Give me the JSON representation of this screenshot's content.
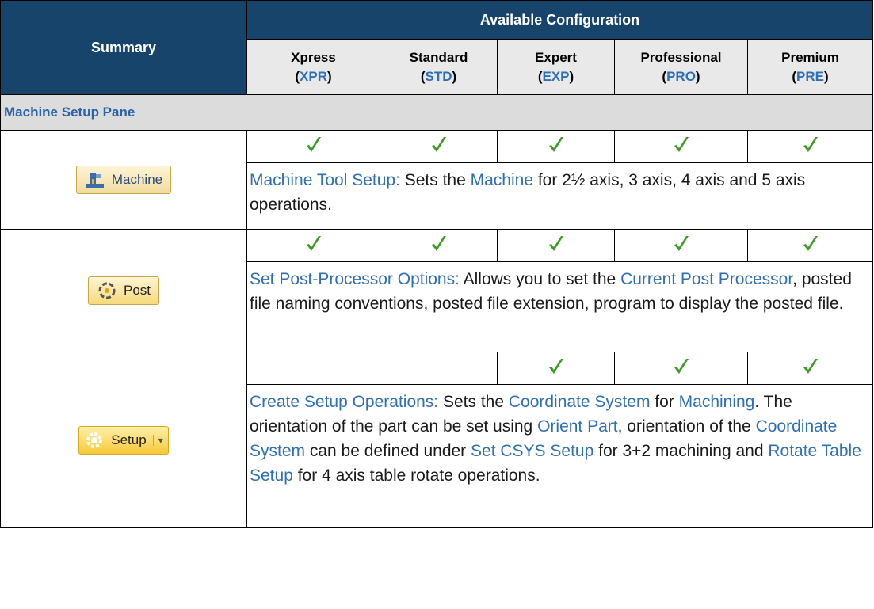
{
  "header": {
    "summary": "Summary",
    "available": "Available Configuration",
    "tiers": [
      {
        "name": "Xpress",
        "abbr": "XPR"
      },
      {
        "name": "Standard",
        "abbr": "STD"
      },
      {
        "name": "Expert",
        "abbr": "EXP"
      },
      {
        "name": "Professional",
        "abbr": "PRO"
      },
      {
        "name": "Premium",
        "abbr": "PRE"
      }
    ]
  },
  "section": {
    "title": "Machine Setup Pane"
  },
  "rows": [
    {
      "button_label": "Machine",
      "icon": "machine-icon",
      "checks": [
        true,
        true,
        true,
        true,
        true
      ],
      "desc": {
        "link1": "Machine Tool Setup:",
        "t1": " Sets the ",
        "link2": "Machine",
        "t2": " for 2½ axis, 3 axis, 4 axis and 5 axis operations."
      }
    },
    {
      "button_label": "Post",
      "icon": "post-icon",
      "checks": [
        true,
        true,
        true,
        true,
        true
      ],
      "desc": {
        "link1": "Set Post-Processor Options:",
        "t1": " Allows you to set the ",
        "link2": "Current Post Processor",
        "t2": ", posted file naming conventions, posted file extension, program to display the posted file."
      }
    },
    {
      "button_label": "Setup",
      "icon": "setup-gear-icon",
      "checks": [
        false,
        false,
        true,
        true,
        true
      ],
      "desc": {
        "link1": "Create Setup Operations:",
        "t1": " Sets the ",
        "link2": "Coordinate System",
        "t2": " for ",
        "link3": "Machining",
        "t3": ". The orientation of the part can be set using ",
        "link4": "Orient Part",
        "t4": ", orientation of the ",
        "link5": "Coordinate System",
        "t5": " can be defined under ",
        "link6": "Set CSYS Setup",
        "t6": " for 3+2 machining and ",
        "link7": "Rotate Table Setup",
        "t7": " for 4 axis table rotate operations."
      }
    }
  ],
  "colors": {
    "header_bg": "#17446a",
    "link": "#2f6fb6",
    "check": "#3c9a25"
  }
}
